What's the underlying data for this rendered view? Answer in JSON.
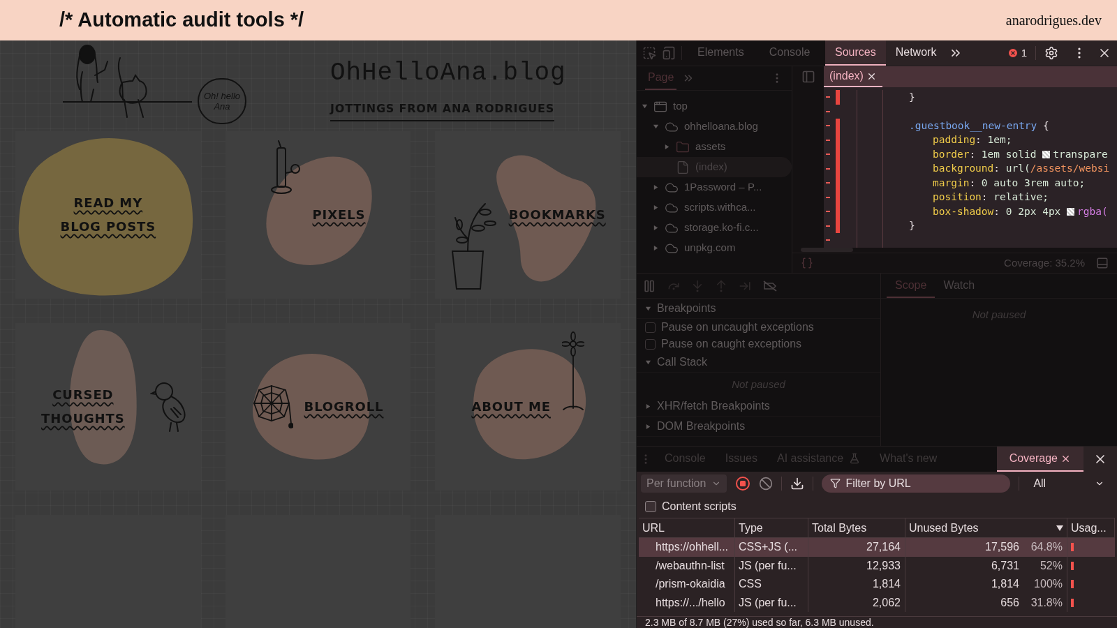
{
  "banner": {
    "title": "/* Automatic audit tools */",
    "site": "anarodrigues.dev"
  },
  "blog": {
    "title": "OhHelloAna.blog",
    "tagline": "JOTTINGS FROM ANA RODRIGUES",
    "speech": "Oh! hello Ana",
    "cards": [
      {
        "label": "READ MY BLOG POSTS",
        "color": "#76673f"
      },
      {
        "label": "PIXELS",
        "color": "#6f5a52"
      },
      {
        "label": "BOOKMARKS",
        "color": "#6f5a52"
      },
      {
        "label": "CURSED THOUGHTS",
        "color": "#6c5b54"
      },
      {
        "label": "BLOGROLL",
        "color": "#6f5a52"
      },
      {
        "label": "ABOUT ME",
        "color": "#6f5a52"
      }
    ]
  },
  "devtools": {
    "tabs": [
      {
        "label": "Elements",
        "selected": false
      },
      {
        "label": "Console",
        "selected": false
      },
      {
        "label": "Sources",
        "selected": true
      },
      {
        "label": "Network",
        "selected": false
      }
    ],
    "error_count": "1",
    "navigator": {
      "tab": "Page",
      "tree": [
        {
          "label": "top",
          "kind": "frame",
          "expanded": true,
          "selected": false,
          "children": [
            {
              "label": "ohhelloana.blog",
              "kind": "domain",
              "expanded": true,
              "selected": false,
              "children": [
                {
                  "label": "assets",
                  "kind": "folder",
                  "expanded": false,
                  "selected": false
                },
                {
                  "label": "(index)",
                  "kind": "file",
                  "selected": true
                }
              ]
            },
            {
              "label": "1Password – P...",
              "kind": "domain",
              "expanded": false,
              "selected": false
            },
            {
              "label": "scripts.withca...",
              "kind": "domain",
              "expanded": false,
              "selected": false
            },
            {
              "label": "storage.ko-fi.c...",
              "kind": "domain",
              "expanded": false,
              "selected": false
            },
            {
              "label": "unpkg.com",
              "kind": "domain",
              "expanded": false,
              "selected": false
            }
          ]
        }
      ]
    },
    "editor": {
      "file_tab": "(index)",
      "lines": [
        {
          "kind": "rule",
          "unused": true,
          "tokens": [
            {
              "kind": "punct",
              "text": "}"
            }
          ]
        },
        {
          "kind": "blank",
          "unused": false
        },
        {
          "kind": "rule",
          "unused": true,
          "tokens": [
            {
              "kind": "selector",
              "text": ".guestbook__new-entry"
            },
            {
              "kind": "punct",
              "text": " {"
            }
          ]
        },
        {
          "kind": "declaration",
          "unused": true,
          "tokens": [
            {
              "kind": "prop",
              "text": "padding"
            },
            {
              "kind": "punct",
              "text": ": "
            },
            {
              "kind": "value",
              "text": "1em;"
            }
          ]
        },
        {
          "kind": "declaration",
          "unused": true,
          "tokens": [
            {
              "kind": "prop",
              "text": "border"
            },
            {
              "kind": "punct",
              "text": ": "
            },
            {
              "kind": "value",
              "text": "1em solid "
            },
            {
              "kind": "swatch"
            },
            {
              "kind": "value",
              "text": "transpare"
            }
          ]
        },
        {
          "kind": "declaration",
          "unused": true,
          "tokens": [
            {
              "kind": "prop",
              "text": "background"
            },
            {
              "kind": "punct",
              "text": ": "
            },
            {
              "kind": "value",
              "text": "url("
            },
            {
              "kind": "url",
              "text": "/assets/websi"
            }
          ]
        },
        {
          "kind": "declaration",
          "unused": true,
          "tokens": [
            {
              "kind": "prop",
              "text": "margin"
            },
            {
              "kind": "punct",
              "text": ": "
            },
            {
              "kind": "value",
              "text": "0 auto 3rem auto;"
            }
          ]
        },
        {
          "kind": "declaration",
          "unused": true,
          "tokens": [
            {
              "kind": "prop",
              "text": "position"
            },
            {
              "kind": "punct",
              "text": ": "
            },
            {
              "kind": "value",
              "text": "relative;"
            }
          ]
        },
        {
          "kind": "declaration",
          "unused": true,
          "tokens": [
            {
              "kind": "prop",
              "text": "box-shadow"
            },
            {
              "kind": "punct",
              "text": ": "
            },
            {
              "kind": "value",
              "text": "0 2px 4px "
            },
            {
              "kind": "swatch"
            },
            {
              "kind": "func",
              "text": "rgba("
            }
          ]
        },
        {
          "kind": "rule",
          "unused": true,
          "tokens": [
            {
              "kind": "punct",
              "text": "}"
            }
          ]
        },
        {
          "kind": "blank",
          "unused": false
        }
      ],
      "coverage": "Coverage: 35.2%"
    },
    "debugger": {
      "sections": [
        {
          "kind": "header",
          "label": "Breakpoints",
          "expanded": true
        },
        {
          "kind": "checkbox",
          "label": "Pause on uncaught exceptions",
          "checked": false
        },
        {
          "kind": "checkbox",
          "label": "Pause on caught exceptions",
          "checked": false
        },
        {
          "kind": "header",
          "label": "Call Stack",
          "expanded": true
        },
        {
          "kind": "message",
          "label": "Not paused"
        },
        {
          "kind": "header",
          "label": "XHR/fetch Breakpoints",
          "expanded": false
        },
        {
          "kind": "header",
          "label": "DOM Breakpoints",
          "expanded": false
        }
      ],
      "scope_tabs": [
        {
          "label": "Scope",
          "selected": true
        },
        {
          "label": "Watch",
          "selected": false
        }
      ],
      "scope_message": "Not paused"
    },
    "drawer": {
      "tabs": [
        {
          "label": "Console",
          "selected": false,
          "experimental": false,
          "closable": false
        },
        {
          "label": "Issues",
          "selected": false,
          "experimental": false,
          "closable": false
        },
        {
          "label": "AI assistance",
          "selected": false,
          "experimental": true,
          "closable": false
        },
        {
          "label": "What's new",
          "selected": false,
          "experimental": false,
          "closable": false
        },
        {
          "label": "Coverage",
          "selected": true,
          "experimental": false,
          "closable": true
        }
      ],
      "mode": "Per function",
      "filter_placeholder": "Filter by URL",
      "type_filter": "All",
      "content_scripts": {
        "label": "Content scripts",
        "checked": false
      },
      "columns": [
        "URL",
        "Type",
        "Total Bytes",
        "Unused Bytes",
        "Usag..."
      ],
      "rows": [
        {
          "url": "https://ohhell...",
          "type": "CSS+JS (...",
          "total": "27,164",
          "unused": "17,596",
          "unused_pct": "64.8%",
          "selected": true
        },
        {
          "url": "/webauthn-list",
          "type": "JS (per fu...",
          "total": "12,933",
          "unused": "6,731",
          "unused_pct": "52%",
          "selected": false
        },
        {
          "url": "/prism-okaidia",
          "type": "CSS",
          "total": "1,814",
          "unused": "1,814",
          "unused_pct": "100%",
          "selected": false
        },
        {
          "url": "https://.../hello",
          "type": "JS (per fu...",
          "total": "2,062",
          "unused": "656",
          "unused_pct": "31.8%",
          "selected": false
        }
      ],
      "status": "2.3 MB of 8.7 MB (27%) used so far, 6.3 MB unused."
    }
  }
}
